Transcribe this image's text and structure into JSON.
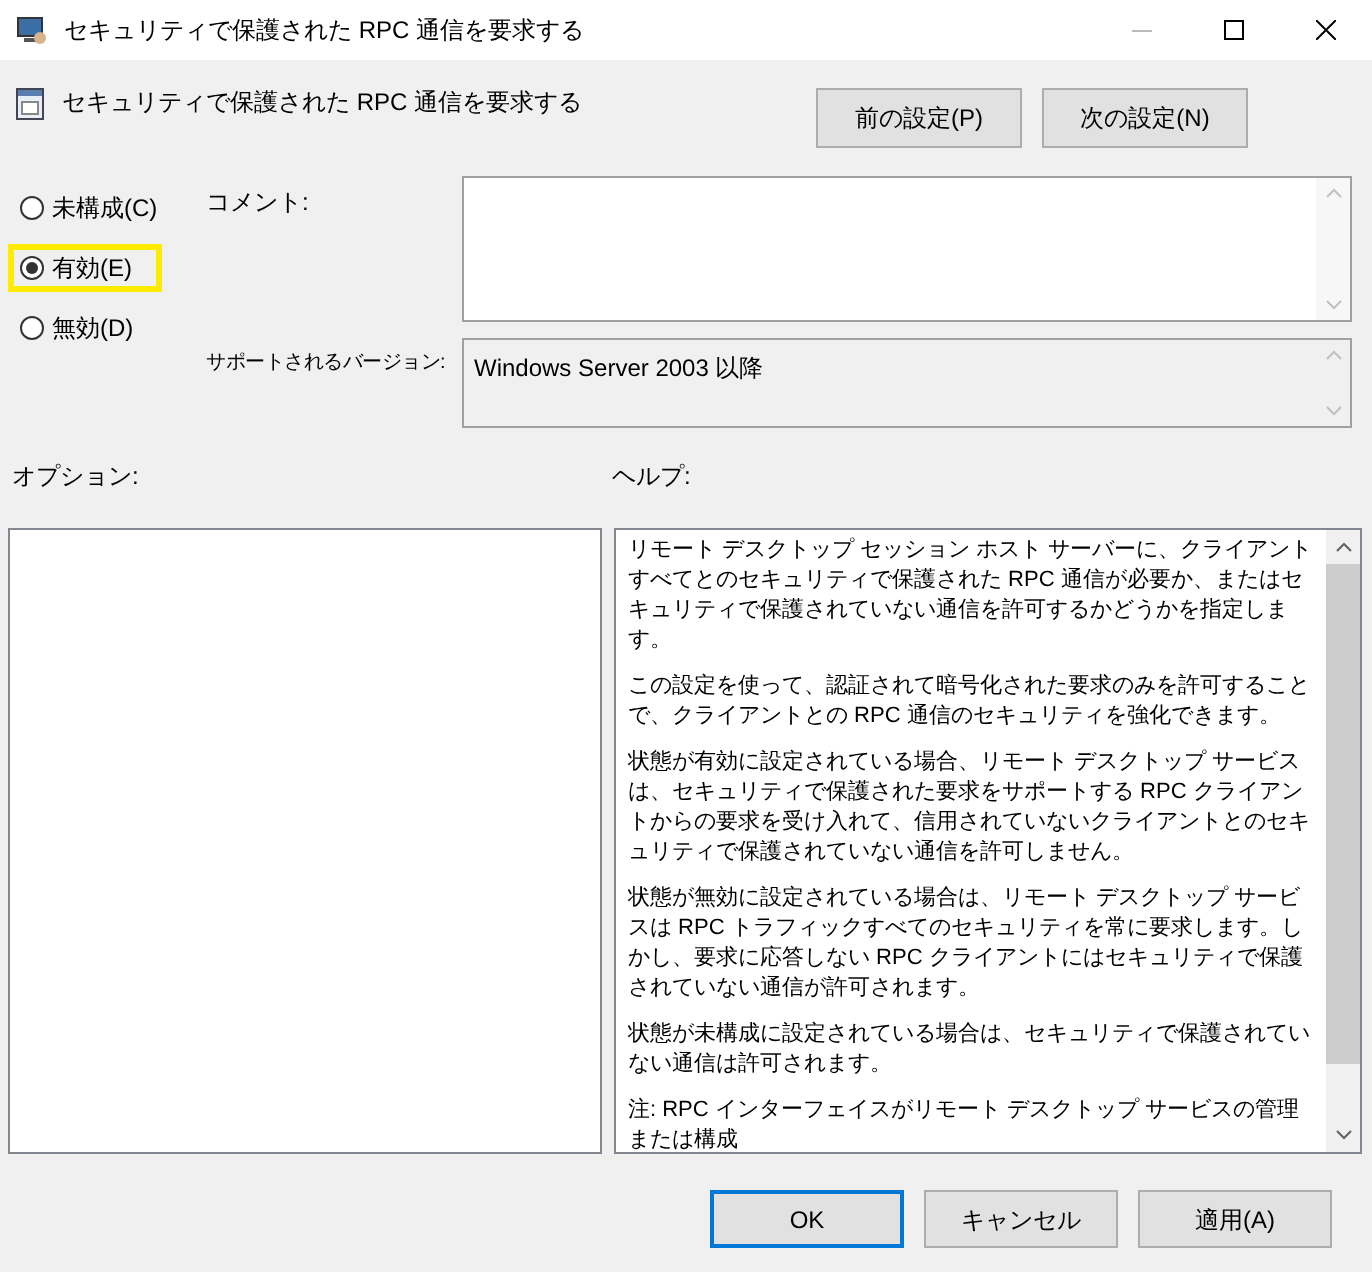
{
  "window": {
    "title": "セキュリティで保護された RPC 通信を要求する"
  },
  "header": {
    "title": "セキュリティで保護された RPC 通信を要求する"
  },
  "nav_buttons": [
    "前の設定(P)",
    "次の設定(N)"
  ],
  "options": [
    {
      "label": "未構成(C)",
      "selected": false,
      "highlighted": false
    },
    {
      "label": "有効(E)",
      "selected": true,
      "highlighted": true
    },
    {
      "label": "無効(D)",
      "selected": false,
      "highlighted": false
    }
  ],
  "comment": {
    "label": "コメント:"
  },
  "supported": {
    "label": "サポートされるバージョン:",
    "value": "Windows Server 2003 以降"
  },
  "options_label": "オプション:",
  "help_label": "ヘルプ:",
  "help_paragraphs": [
    "リモート デスクトップ セッション ホスト サーバーに、クライアントすべてとのセキュリティで保護された RPC 通信が必要か、またはセキュリティで保護されていない通信を許可するかどうかを指定します。",
    "この設定を使って、認証されて暗号化された要求のみを許可することで、クライアントとの RPC 通信のセキュリティを強化できます。",
    "状態が有効に設定されている場合、リモート デスクトップ サービスは、セキュリティで保護された要求をサポートする RPC クライアントからの要求を受け入れて、信用されていないクライアントとのセキュリティで保護されていない通信を許可しません。",
    "状態が無効に設定されている場合は、リモート デスクトップ サービスは RPC トラフィックすべてのセキュリティを常に要求します。しかし、要求に応答しない RPC クライアントにはセキュリティで保護されていない通信が許可されます。",
    "状態が未構成に設定されている場合は、セキュリティで保護されていない通信は許可されます。",
    "注: RPC インターフェイスがリモート デスクトップ サービスの管理または構成"
  ],
  "footer_buttons": [
    {
      "label": "OK",
      "default": true
    },
    {
      "label": "キャンセル",
      "default": false
    },
    {
      "label": "適用(A)",
      "default": false
    }
  ]
}
